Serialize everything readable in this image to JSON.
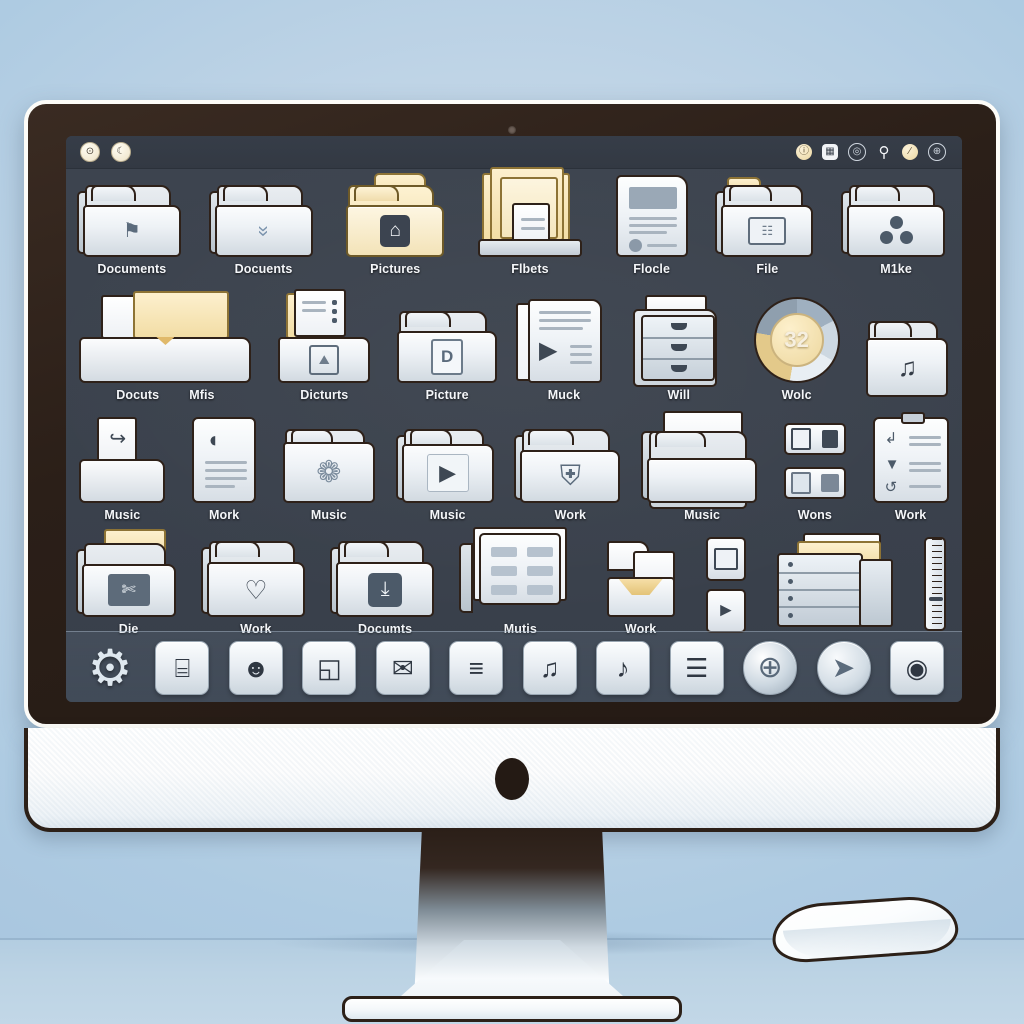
{
  "scene": {
    "description": "Desktop computer monitor displaying a file manager desktop full of folder icons",
    "background_color": "#bfd4e6",
    "bezel_color": "#241a14",
    "screen_background": "#3a414c"
  },
  "titlebar": {
    "left_buttons": [
      {
        "name": "record-button",
        "glyph": "⊙"
      },
      {
        "name": "moon-button",
        "glyph": "☾"
      }
    ],
    "status_icons": [
      {
        "name": "user-status-icon",
        "glyph": "ⓘ",
        "style": "amber"
      },
      {
        "name": "grid-icon",
        "glyph": "▦",
        "style": "wht"
      },
      {
        "name": "target-icon",
        "glyph": "◎",
        "style": "ghost"
      },
      {
        "name": "bottle-icon",
        "glyph": "⚲",
        "style": "bottle"
      },
      {
        "name": "battery-icon",
        "glyph": "∕",
        "style": "amber"
      },
      {
        "name": "settings-icon",
        "glyph": "⊕",
        "style": "ghost"
      }
    ]
  },
  "desktop": {
    "rows": [
      {
        "id": "row-1",
        "items": [
          {
            "label": "Documents",
            "icon": "folder-stack-badge-icon",
            "glyph": "⚑"
          },
          {
            "label": "Docuents",
            "icon": "folder-chevron-down-icon",
            "glyph": "»"
          },
          {
            "label": "Pictures",
            "icon": "folder-home-icon",
            "glyph": "⌂"
          },
          {
            "label": "Flbets",
            "icon": "folder-documents-stack-icon",
            "glyph": "☰"
          },
          {
            "label": "Flocle",
            "icon": "document-page-icon",
            "glyph": "☷"
          },
          {
            "label": "File",
            "icon": "folder-image-icon",
            "glyph": "☷"
          },
          {
            "label": "M1ke",
            "icon": "folder-shared-users-icon",
            "glyph": "∴"
          }
        ]
      },
      {
        "id": "row-2",
        "items": [
          {
            "label": "Docuts",
            "icon": "open-folder-manila-icon",
            "glyph": ""
          },
          {
            "label": "Mfis",
            "icon": "open-folder-manila-icon-2",
            "glyph": ""
          },
          {
            "label": "Dicturts",
            "icon": "folder-photos-icon",
            "glyph": "⛰"
          },
          {
            "label": "Picture",
            "icon": "folder-document-d-icon",
            "glyph": "D"
          },
          {
            "label": "Muck",
            "icon": "document-video-icon",
            "glyph": "▶"
          },
          {
            "label": "Will",
            "icon": "folder-drawers-icon",
            "glyph": "⌸"
          },
          {
            "label": "Wolc",
            "icon": "pie-chart-32-icon",
            "glyph": "32"
          },
          {
            "label": "",
            "icon": "folder-music-icon",
            "glyph": "♫"
          }
        ]
      },
      {
        "id": "row-3",
        "items": [
          {
            "label": "Music",
            "icon": "folder-open-inbox-icon",
            "glyph": "↪"
          },
          {
            "label": "Mork",
            "icon": "document-text-icon",
            "glyph": "☰"
          },
          {
            "label": "Music",
            "icon": "folder-flower-icon",
            "glyph": "❁"
          },
          {
            "label": "Music",
            "icon": "folder-play-icon",
            "glyph": "▶"
          },
          {
            "label": "Work",
            "icon": "folder-shield-icon",
            "glyph": "⛨"
          },
          {
            "label": "Music",
            "icon": "folder-stack-plain-icon",
            "glyph": ""
          },
          {
            "label": "Wons",
            "icon": "window-panels-icon",
            "glyph": "▤"
          },
          {
            "label": "Work",
            "icon": "clipboard-form-icon",
            "glyph": "≡"
          }
        ]
      },
      {
        "id": "row-4",
        "items": [
          {
            "label": "Die",
            "icon": "folder-tools-icon",
            "glyph": "✄"
          },
          {
            "label": "Work",
            "icon": "folder-heart-icon",
            "glyph": "♡"
          },
          {
            "label": "Documts",
            "icon": "folder-download-icon",
            "glyph": "⤓"
          },
          {
            "label": "Mutis",
            "icon": "folder-list-grid-icon",
            "glyph": "☷"
          },
          {
            "label": "Work",
            "icon": "folder-inbox-manila-icon",
            "glyph": "⬇"
          },
          {
            "label": "",
            "icon": "device-tablet-icon",
            "glyph": "□"
          },
          {
            "label": "",
            "icon": "server-rack-icon",
            "glyph": "☰"
          },
          {
            "label": "",
            "icon": "ruler-icon",
            "glyph": "‖"
          }
        ]
      }
    ]
  },
  "dock": {
    "items": [
      {
        "name": "system-preferences-gear-icon",
        "glyph": "⚙",
        "style": "gear"
      },
      {
        "name": "folder-barcode-icon",
        "glyph": "⌸",
        "style": "tile"
      },
      {
        "name": "contacts-user-icon",
        "glyph": "☻",
        "style": "tile"
      },
      {
        "name": "app-switcher-icon",
        "glyph": "◱",
        "style": "tile"
      },
      {
        "name": "mail-envelope-icon",
        "glyph": "✉",
        "style": "tile"
      },
      {
        "name": "text-document-icon",
        "glyph": "≡",
        "style": "tile"
      },
      {
        "name": "music-folder-icon",
        "glyph": "♫",
        "style": "tile"
      },
      {
        "name": "music-note-icon",
        "glyph": "♪",
        "style": "tile"
      },
      {
        "name": "list-document-icon",
        "glyph": "☰",
        "style": "tile"
      },
      {
        "name": "globe-network-icon",
        "glyph": "⊕",
        "style": "globe"
      },
      {
        "name": "safari-compass-icon",
        "glyph": "➤",
        "style": "compass"
      },
      {
        "name": "disc-media-icon",
        "glyph": "◉",
        "style": "tile"
      }
    ]
  }
}
